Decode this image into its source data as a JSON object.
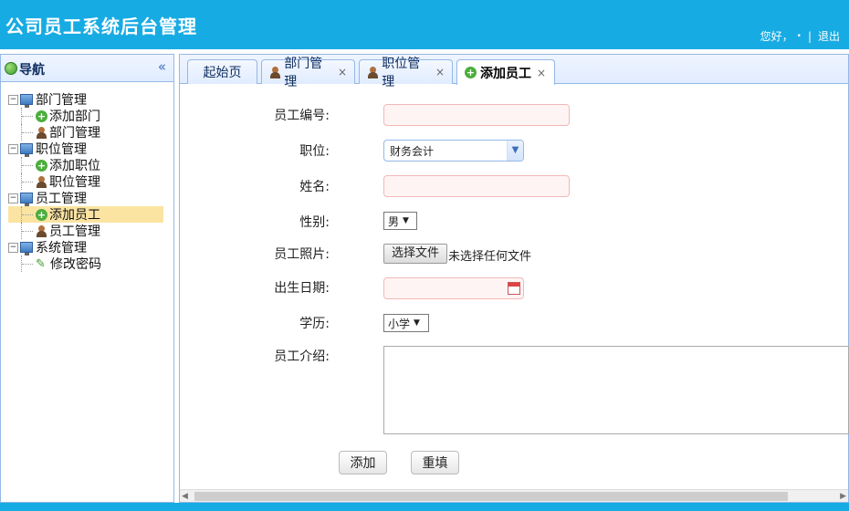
{
  "header": {
    "title": "公司员工系统后台管理",
    "greeting": "您好，",
    "user_marker": "•",
    "separator": "|",
    "logout": "退出"
  },
  "sidebar": {
    "title": "导航",
    "collapse_glyph": "«",
    "groups": [
      {
        "label": "部门管理",
        "children": [
          {
            "label": "添加部门",
            "icon": "add-icon"
          },
          {
            "label": "部门管理",
            "icon": "user-icon"
          }
        ]
      },
      {
        "label": "职位管理",
        "children": [
          {
            "label": "添加职位",
            "icon": "add-icon"
          },
          {
            "label": "职位管理",
            "icon": "user-icon"
          }
        ]
      },
      {
        "label": "员工管理",
        "children": [
          {
            "label": "添加员工",
            "icon": "add-icon",
            "selected": true
          },
          {
            "label": "员工管理",
            "icon": "user-icon"
          }
        ]
      },
      {
        "label": "系统管理",
        "children": [
          {
            "label": "修改密码",
            "icon": "pencil-icon"
          }
        ]
      }
    ]
  },
  "tabs": [
    {
      "label": "起始页",
      "closable": false
    },
    {
      "label": "部门管理",
      "closable": true,
      "close": "×"
    },
    {
      "label": "职位管理",
      "closable": true,
      "close": "×"
    },
    {
      "label": "添加员工",
      "closable": true,
      "close": "×",
      "active": true
    }
  ],
  "form": {
    "emp_no_label": "员工编号:",
    "position_label": "职位:",
    "position_value": "财务会计",
    "name_label": "姓名:",
    "gender_label": "性别:",
    "gender_value": "男",
    "photo_label": "员工照片:",
    "file_button": "选择文件",
    "file_status": "未选择任何文件",
    "birth_label": "出生日期:",
    "education_label": "学历:",
    "education_value": "小学",
    "intro_label": "员工介绍:",
    "add_button": "添加",
    "reset_button": "重填"
  },
  "colors": {
    "header_bg": "#17abe3",
    "border": "#95b8e7",
    "selected_row": "#fbe4a2",
    "invalid_input_border": "#f2b8b8"
  }
}
